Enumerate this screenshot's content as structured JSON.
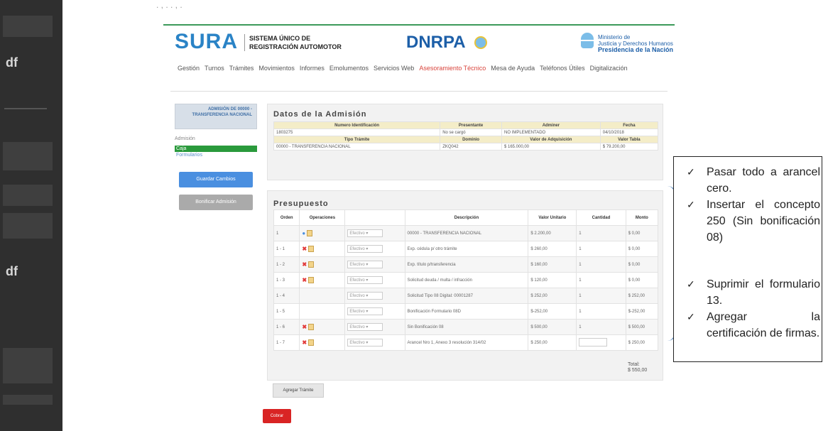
{
  "left_strip": {
    "fragments": [
      "df",
      "df"
    ]
  },
  "top_fragment": ". , . . , .",
  "header": {
    "logo": "SURA",
    "system_line1": "SISTEMA ÚNICO DE",
    "system_line2": "REGISTRACIÓN AUTOMOTOR",
    "dnrpa": "DNRPA",
    "ministry_line1": "Ministerio de",
    "ministry_line2": "Justicia y Derechos Humanos",
    "ministry_line3": "Presidencia de la Nación"
  },
  "nav": {
    "items": [
      "Gestión",
      "Turnos",
      "Trámites",
      "Movimientos",
      "Informes",
      "Emolumentos",
      "Servicios Web",
      "Asesoramiento Técnico",
      "Mesa de Ayuda",
      "Teléfonos Útiles",
      "Digitalización"
    ],
    "active_index": 7
  },
  "sidebar": {
    "header": "ADMISIÓN DE 00000 - TRANSFERENCIA NACIONAL",
    "section_label": "Admisión",
    "caja": "Caja",
    "formularios": "Formularios",
    "guardar": "Guardar Cambios",
    "bonificar": "Bonificar Admisión"
  },
  "admision": {
    "title": "Datos de la Admisión",
    "headers1": [
      "Numero Identificación",
      "Presentante",
      "Adminer",
      "Fecha"
    ],
    "row1": [
      "1803275",
      "No se cargó",
      "NO IMPLEMENTADO",
      "04/10/2018"
    ],
    "headers2": [
      "Tipo Trámite",
      "Dominio",
      "Valor de Adquisición",
      "Valor Tabla"
    ],
    "row2": [
      "00000 - TRANSFERENCIA NACIONAL",
      "ZKQ042",
      "$ 165.000,00",
      "$ 79.200,00"
    ]
  },
  "presupuesto": {
    "title": "Presupuesto",
    "headers": [
      "Orden",
      "Operaciones",
      "",
      "Descripción",
      "Valor Unitario",
      "Cantidad",
      "Monto"
    ],
    "select_value": "Efectivo",
    "rows": [
      {
        "orden": "1",
        "ops": "add",
        "desc": "00000 - TRANSFERENCIA NACIONAL",
        "valor": "$ 2.200,00",
        "cant": "1",
        "monto": "$ 0,00"
      },
      {
        "orden": "1 - 1",
        "ops": "del",
        "desc": "Exp. cédula p/ otro trámite",
        "valor": "$ 260,00",
        "cant": "1",
        "monto": "$ 0,00"
      },
      {
        "orden": "1 - 2",
        "ops": "del",
        "desc": "Exp. título p/transferencia",
        "valor": "$ 160,00",
        "cant": "1",
        "monto": "$ 0,00"
      },
      {
        "orden": "1 - 3",
        "ops": "del",
        "desc": "Solicitud deuda / multa / infracción",
        "valor": "$ 120,00",
        "cant": "1",
        "monto": "$ 0,00"
      },
      {
        "orden": "1 - 4",
        "ops": "",
        "desc": "Solicitud Tipo 08 Digital: 00001287",
        "valor": "$ 252,00",
        "cant": "1",
        "monto": "$ 252,00"
      },
      {
        "orden": "1 - 5",
        "ops": "",
        "desc": "Bonificación Formulario 08D",
        "valor": "$-252,00",
        "cant": "1",
        "monto": "$-252,00"
      },
      {
        "orden": "1 - 6",
        "ops": "del",
        "desc": "Sin Bonificación 08",
        "valor": "$ 500,00",
        "cant": "1",
        "monto": "$ 500,00"
      },
      {
        "orden": "1 - 7",
        "ops": "del",
        "desc": "Arancel Nro 1, Anexo 3 resolución 314/02",
        "valor": "$ 250,00",
        "cant": "",
        "monto": "$ 250,00"
      }
    ],
    "total_label": "Total:",
    "total_value": "$ 550,00",
    "agregar": "Agregar Trámite",
    "cobrar": "Cobrar"
  },
  "annotation": {
    "items": [
      "Pasar todo a arancel cero.",
      "Insertar el concepto 250 (Sin bonificación 08)",
      "Suprimir el formulario 13.",
      "Agregar la certificación de firmas."
    ],
    "check": "✓",
    "bracket_color": "#2b6bb0"
  }
}
